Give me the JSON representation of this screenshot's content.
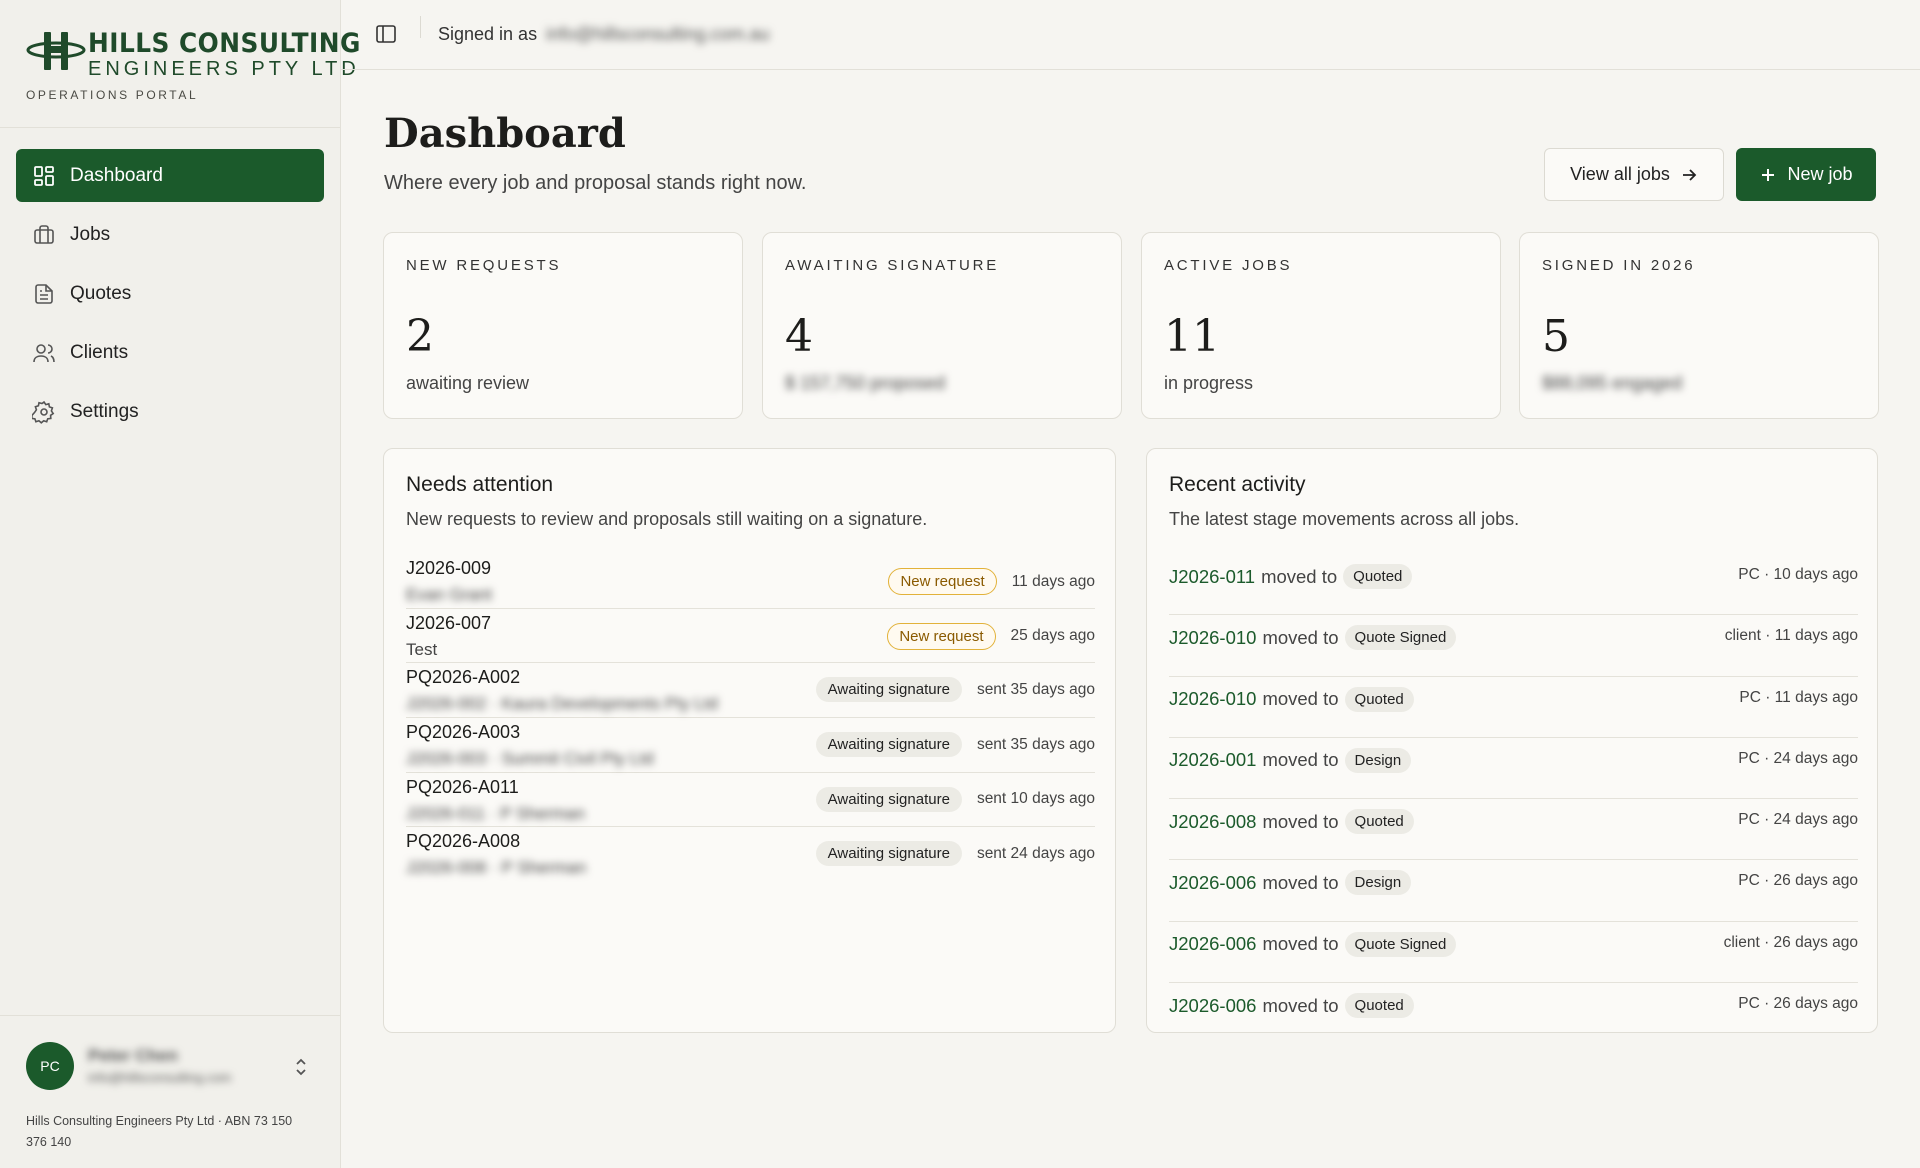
{
  "brand": {
    "line1": "HILLS CONSULTING",
    "line2": "ENGINEERS PTY LTD",
    "subtitle": "OPERATIONS PORTAL",
    "color": "#1f4a2a"
  },
  "sidebar": {
    "items": [
      {
        "label": "Dashboard",
        "icon": "dashboard-grid-icon",
        "active": true
      },
      {
        "label": "Jobs",
        "icon": "briefcase-icon",
        "active": false
      },
      {
        "label": "Quotes",
        "icon": "document-icon",
        "active": false
      },
      {
        "label": "Clients",
        "icon": "users-icon",
        "active": false
      },
      {
        "label": "Settings",
        "icon": "gear-icon",
        "active": false
      }
    ],
    "user": {
      "initials": "PC",
      "name": "Peter Chen",
      "email": "info@hillsconsulting.com"
    },
    "company_line": "Hills Consulting Engineers Pty Ltd · ABN 73 150 376 140"
  },
  "topbar": {
    "signed_in_label": "Signed in as",
    "signed_in_email": "info@hillsconsulting.com.au"
  },
  "header": {
    "title": "Dashboard",
    "subtitle": "Where every job and proposal stands right now.",
    "view_all_label": "View all jobs",
    "new_job_label": "New job"
  },
  "stats": [
    {
      "label": "NEW REQUESTS",
      "value": "2",
      "sub": "awaiting review",
      "sub_blurred": false
    },
    {
      "label": "AWAITING SIGNATURE",
      "value": "4",
      "sub": "$ 157,750 proposed",
      "sub_blurred": true
    },
    {
      "label": "ACTIVE JOBS",
      "value": "11",
      "sub": "in progress",
      "sub_blurred": false
    },
    {
      "label": "SIGNED IN 2026",
      "value": "5",
      "sub": "$88,095 engaged",
      "sub_blurred": true
    }
  ],
  "attention": {
    "title": "Needs attention",
    "subtitle": "New requests to review and proposals still waiting on a signature.",
    "rows": [
      {
        "code": "J2026-009",
        "desc": "Evan Grant",
        "desc_blurred": true,
        "badge": "New request",
        "badge_type": "new",
        "time": "11 days ago"
      },
      {
        "code": "J2026-007",
        "desc": "Test",
        "desc_blurred": false,
        "badge": "New request",
        "badge_type": "new",
        "time": "25 days ago"
      },
      {
        "code": "PQ2026-A002",
        "desc": "J2026-002 · Kaura Developments Pty Ltd",
        "desc_blurred": true,
        "badge": "Awaiting signature",
        "badge_type": "await",
        "time": "sent 35 days ago"
      },
      {
        "code": "PQ2026-A003",
        "desc": "J2026-003 · Summit Civil Pty Ltd",
        "desc_blurred": true,
        "badge": "Awaiting signature",
        "badge_type": "await",
        "time": "sent 35 days ago"
      },
      {
        "code": "PQ2026-A011",
        "desc": "J2026-011 · P Sherman",
        "desc_blurred": true,
        "badge": "Awaiting signature",
        "badge_type": "await",
        "time": "sent 10 days ago"
      },
      {
        "code": "PQ2026-A008",
        "desc": "J2026-008 · P Sherman",
        "desc_blurred": true,
        "badge": "Awaiting signature",
        "badge_type": "await",
        "time": "sent 24 days ago"
      }
    ]
  },
  "activity": {
    "title": "Recent activity",
    "subtitle": "The latest stage movements across all jobs.",
    "moved_to_label": "moved to",
    "rows": [
      {
        "code": "J2026-011",
        "stage": "Quoted",
        "meta": "PC · 10 days ago"
      },
      {
        "code": "J2026-010",
        "stage": "Quote Signed",
        "meta": "client · 11 days ago"
      },
      {
        "code": "J2026-010",
        "stage": "Quoted",
        "meta": "PC · 11 days ago"
      },
      {
        "code": "J2026-001",
        "stage": "Design",
        "meta": "PC · 24 days ago"
      },
      {
        "code": "J2026-008",
        "stage": "Quoted",
        "meta": "PC · 24 days ago"
      },
      {
        "code": "J2026-006",
        "stage": "Design",
        "meta": "PC · 26 days ago"
      },
      {
        "code": "J2026-006",
        "stage": "Quote Signed",
        "meta": "client · 26 days ago"
      },
      {
        "code": "J2026-006",
        "stage": "Quoted",
        "meta": "PC · 26 days ago"
      }
    ]
  },
  "colors": {
    "primary": "#1b5a2b",
    "background": "#f6f5f1",
    "badge_new_border": "#e2b23a"
  }
}
